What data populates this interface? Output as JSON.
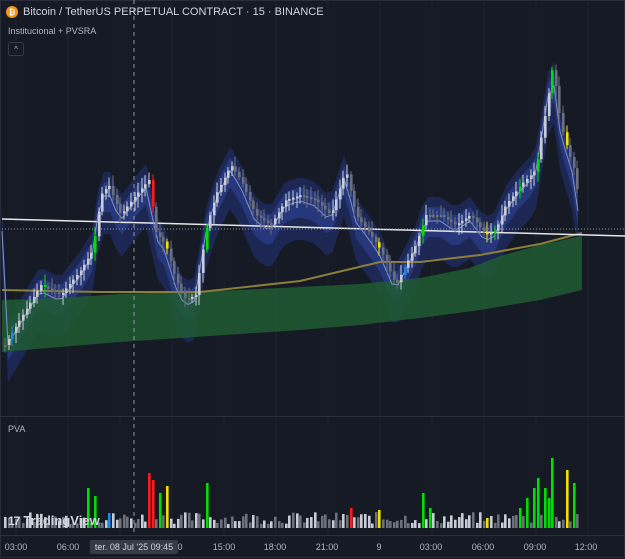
{
  "header": {
    "coin_glyph": "₿",
    "title": "Bitcoin / TetherUS PERPETUAL CONTRACT · 15 · BINANCE",
    "indicator": "Institucional + PVSRA",
    "collapse_glyph": "^"
  },
  "volume_pane": {
    "label": "PVA"
  },
  "x_axis": {
    "ticks": [
      "03:00",
      "06:00",
      "0",
      "15:00",
      "18:00",
      "21:00",
      "9",
      "03:00",
      "06:00",
      "09:00",
      "12:00"
    ],
    "crosshair_label": "ter. 08 Jul '25   09:45"
  },
  "watermark": {
    "logo": "17",
    "text": "TradingView"
  },
  "colors": {
    "background": "#161a25",
    "bull_climax": "#00e000",
    "bear_climax": "#ff1a1a",
    "bull_high": "#1e88e5",
    "bear_high": "#f0e000",
    "normal": "#8d929c",
    "band_fill": "#283a80",
    "cloud_fill": "#1f5c33",
    "ema_line": "#8a7f3a",
    "price_line": "#e6e6e6"
  },
  "chart_data": {
    "type": "candlestick",
    "panes": [
      "price",
      "volume"
    ],
    "x_ticks": [
      "03:00",
      "06:00",
      "0",
      "15:00",
      "18:00",
      "21:00",
      "9",
      "03:00",
      "06:00",
      "09:00",
      "12:00"
    ],
    "series": [
      {
        "name": "PVSRA volume",
        "type": "bar"
      }
    ]
  }
}
